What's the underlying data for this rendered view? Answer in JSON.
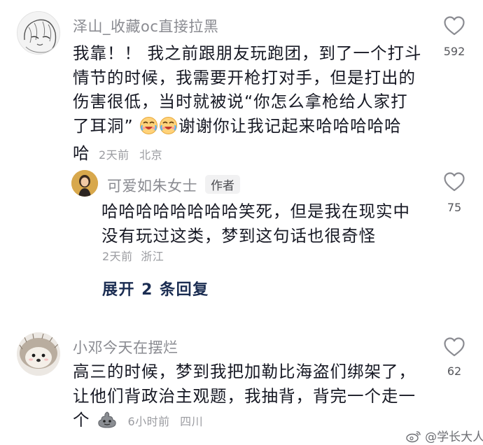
{
  "comments": [
    {
      "username": "泽山_收藏oc直接拉黑",
      "lines": [
        "我靠！！ 我之前跟朋友玩跑团，到了一个打斗",
        "情节的时候，我需要开枪打对手，但是打出的",
        "伤害很低，当时就被说“你怎么拿枪给人家打",
        "了耳洞”",
        "谢谢你让我记起来哈哈哈哈哈",
        "哈"
      ],
      "emojis": [
        "crying-laughing-emoji",
        "crying-laughing-emoji"
      ],
      "time": "2天前",
      "location": "北京",
      "likes": "592"
    },
    {
      "username": "可爱如朱女士",
      "badge": "作者",
      "lines": [
        "哈哈哈哈哈哈哈哈笑死，但是我在现实中",
        "没有玩过这类，梦到这句话也很奇怪"
      ],
      "time": "2天前",
      "location": "浙江",
      "likes": "75"
    },
    {
      "username": "小邓今天在摆烂",
      "lines": [
        "高三的时候，梦到我把加勒比海盗们绑架了，",
        "让他们背政治主观题，我抽背，背完一个走一",
        "个"
      ],
      "emojis": [
        "poop-emoji"
      ],
      "time": "6小时前",
      "location": "四川",
      "likes": "62"
    }
  ],
  "expand_replies": "展开 2 条回复",
  "watermark": "@学长大人",
  "icons": [
    "heart-outline-icon",
    "weibo-logo-icon"
  ],
  "colors": {
    "text": "#161823",
    "secondary": "#8a8b91",
    "meta": "#9b9ca1",
    "expand": "#1b2d52"
  }
}
